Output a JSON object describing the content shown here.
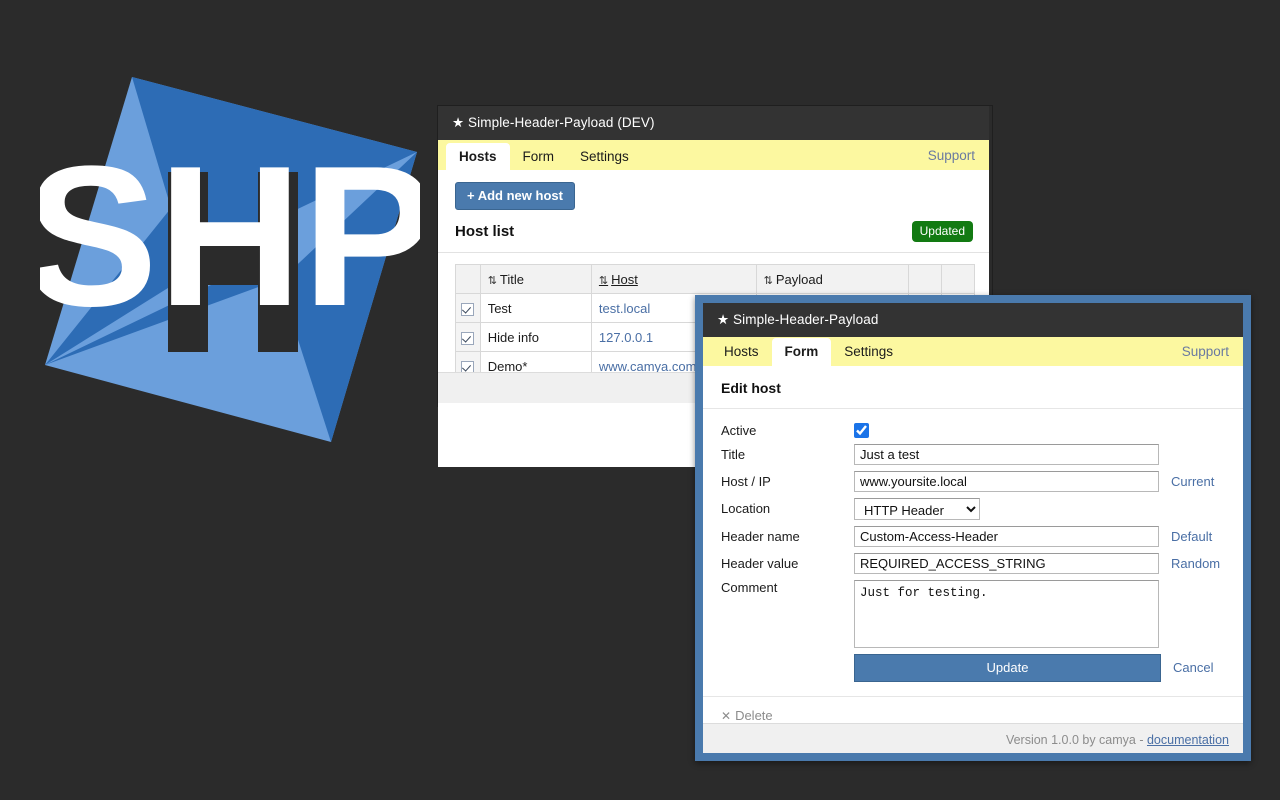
{
  "logo": {
    "text": "SHP",
    "square_color": "#6b9fdc",
    "star_color": "#2d6cb5",
    "background": "#2b2b2b"
  },
  "back_window": {
    "title": "★ Simple-Header-Payload (DEV)",
    "star_icon": "star-icon",
    "tabs": [
      {
        "label": "Hosts",
        "active": true
      },
      {
        "label": "Form",
        "active": false
      },
      {
        "label": "Settings",
        "active": false
      }
    ],
    "support_label": "Support",
    "add_button": "+ Add new host",
    "section_title": "Host list",
    "status_badge": "Updated",
    "table": {
      "sort_icon": "⇅",
      "headers": [
        "",
        "Title",
        "Host",
        "Payload",
        "",
        ""
      ],
      "rows": [
        {
          "checked": true,
          "title": "Test",
          "host": "test.local",
          "payload": ""
        },
        {
          "checked": true,
          "title": "Hide info",
          "host": "127.0.0.1",
          "payload": ""
        },
        {
          "checked": true,
          "title": "Demo*",
          "host": "www.camya.com",
          "payload": ""
        }
      ]
    }
  },
  "front_window": {
    "title": "★ Simple-Header-Payload",
    "tabs": [
      {
        "label": "Hosts",
        "active": false
      },
      {
        "label": "Form",
        "active": true
      },
      {
        "label": "Settings",
        "active": false
      }
    ],
    "support_label": "Support",
    "form_title": "Edit host",
    "fields": {
      "active_label": "Active",
      "active_checked": true,
      "title_label": "Title",
      "title_value": "Just a test",
      "host_label": "Host / IP",
      "host_value": "www.yoursite.local",
      "host_link": "Current",
      "location_label": "Location",
      "location_value": "HTTP Header",
      "location_options": [
        "HTTP Header"
      ],
      "header_name_label": "Header name",
      "header_name_value": "Custom-Access-Header",
      "header_name_link": "Default",
      "header_value_label": "Header value",
      "header_value_value": "REQUIRED_ACCESS_STRING",
      "header_value_link": "Random",
      "comment_label": "Comment",
      "comment_value": "Just for testing."
    },
    "update_button": "Update",
    "cancel_link": "Cancel",
    "delete_label": "Delete",
    "delete_icon": "✕",
    "footer": {
      "text": "Version 1.0.0 by camya - ",
      "link": "documentation"
    }
  },
  "colors": {
    "accent_blue": "#4a7aad",
    "tab_yellow": "#fcf8a0",
    "badge_green": "#127a12",
    "link_blue": "#4a6fa5"
  }
}
